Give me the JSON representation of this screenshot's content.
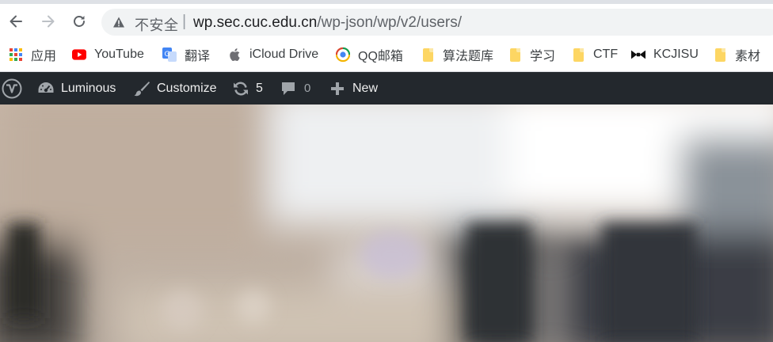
{
  "browser": {
    "address_bar": {
      "security_label": "不安全",
      "url_host": "wp.sec.cuc.edu.cn",
      "url_path": "/wp-json/wp/v2/users/"
    }
  },
  "bookmarks": [
    {
      "label": "应用",
      "icon": "apps-grid-icon"
    },
    {
      "label": "YouTube",
      "icon": "youtube-icon",
      "color": "#ff0000"
    },
    {
      "label": "翻译",
      "icon": "translate-icon",
      "color": "#4285f4"
    },
    {
      "label": "iCloud Drive",
      "icon": "apple-icon"
    },
    {
      "label": "QQ邮箱",
      "icon": "qq-mail-icon"
    },
    {
      "label": "算法题库",
      "icon": "folder-icon"
    },
    {
      "label": "学习",
      "icon": "folder-icon"
    },
    {
      "label": "CTF",
      "icon": "folder-icon"
    },
    {
      "label": "KCJISU",
      "icon": "bowtie-icon"
    },
    {
      "label": "素材",
      "icon": "folder-icon"
    }
  ],
  "admin_bar": {
    "site_name": "Luminous",
    "customize_label": "Customize",
    "updates_count": "5",
    "comments_count": "0",
    "new_label": "New",
    "background_color": "#23282d"
  }
}
